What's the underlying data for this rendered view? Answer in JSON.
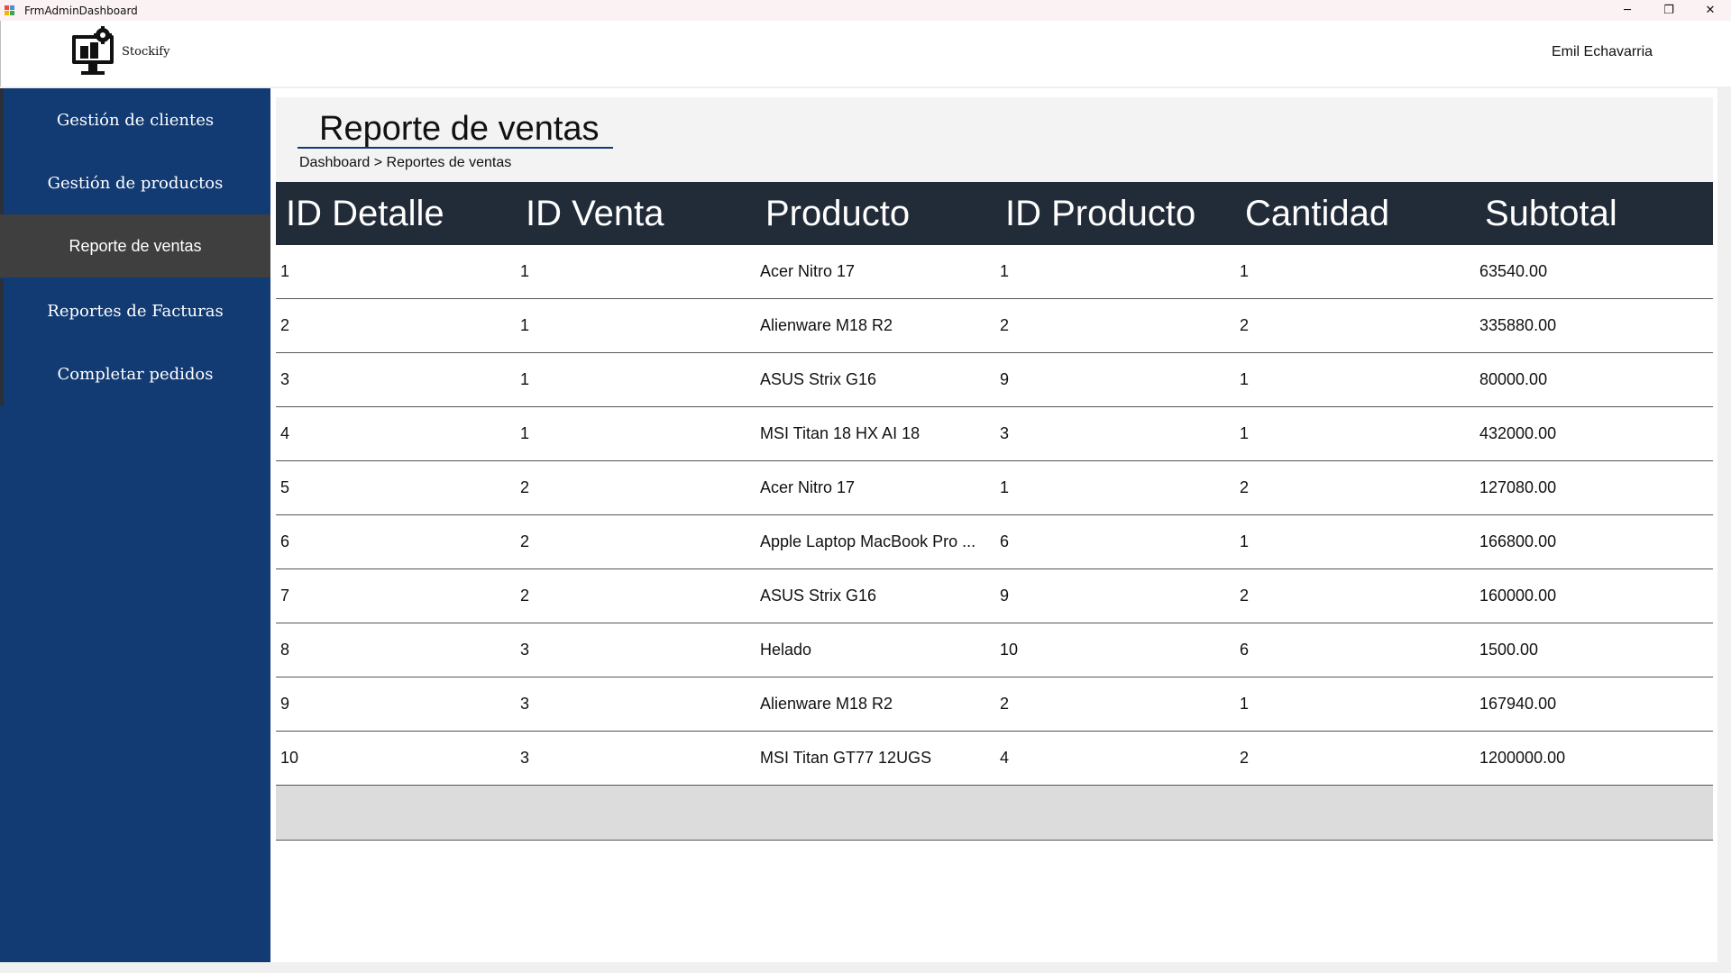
{
  "window": {
    "title": "FrmAdminDashboard",
    "minimize_glyph": "─",
    "restore_glyph": "❐",
    "close_glyph": "✕"
  },
  "header": {
    "brand": "Stockify",
    "user_name": "Emil Echavarria",
    "logo_icon": "computer-gear-icon"
  },
  "sidebar": {
    "items": [
      {
        "label": "Gestión de clientes",
        "active": false
      },
      {
        "label": "Gestión de productos",
        "active": false
      },
      {
        "label": "Reporte de ventas",
        "active": true
      },
      {
        "label": "Reportes de Facturas",
        "active": false
      },
      {
        "label": "Completar pedidos",
        "active": false
      }
    ]
  },
  "page": {
    "title": "Reporte de ventas",
    "breadcrumb": "Dashboard > Reportes de ventas"
  },
  "table": {
    "columns": [
      "ID Detalle",
      "ID Venta",
      "Producto",
      "ID Producto",
      "Cantidad",
      "Subtotal"
    ],
    "rows": [
      [
        "1",
        "1",
        "Acer Nitro 17",
        "1",
        "1",
        "63540.00"
      ],
      [
        "2",
        "1",
        "Alienware M18 R2",
        "2",
        "2",
        "335880.00"
      ],
      [
        "3",
        "1",
        "ASUS Strix G16",
        "9",
        "1",
        "80000.00"
      ],
      [
        "4",
        "1",
        "MSI Titan 18 HX AI 18",
        "3",
        "1",
        "432000.00"
      ],
      [
        "5",
        "2",
        "Acer Nitro 17",
        "1",
        "2",
        "127080.00"
      ],
      [
        "6",
        "2",
        "Apple Laptop MacBook Pro ...",
        "6",
        "1",
        "166800.00"
      ],
      [
        "7",
        "2",
        "ASUS Strix G16",
        "9",
        "2",
        "160000.00"
      ],
      [
        "8",
        "3",
        "Helado",
        "10",
        "6",
        "1500.00"
      ],
      [
        "9",
        "3",
        "Alienware M18 R2",
        "2",
        "1",
        "167940.00"
      ],
      [
        "10",
        "3",
        "MSI Titan GT77 12UGS",
        "4",
        "2",
        "1200000.00"
      ]
    ]
  },
  "colors": {
    "sidebar": "#123a73",
    "sidebar_active": "#3f3f3f",
    "grid_header": "#222b38",
    "new_row": "#dcdcdc"
  }
}
